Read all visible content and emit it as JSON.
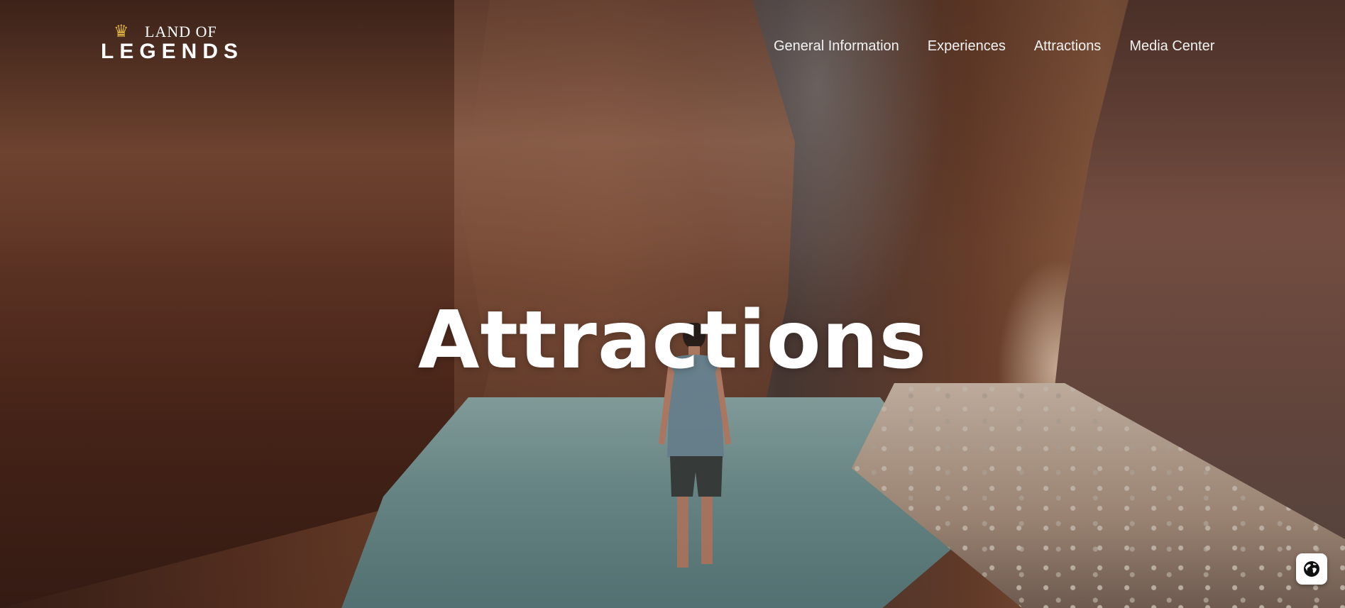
{
  "brand": {
    "logo_top": "LAND OF",
    "logo_bottom": "LEGENDS",
    "crown_icon": "crown-icon"
  },
  "nav": {
    "items": [
      {
        "label": "General Information"
      },
      {
        "label": "Experiences"
      },
      {
        "label": "Attractions"
      },
      {
        "label": "Media Center"
      }
    ]
  },
  "hero": {
    "title": "Attractions",
    "background": "canyon-hiker-photo"
  },
  "widgets": {
    "language_button_icon": "globe-icon"
  },
  "colors": {
    "crown": "#e0b443",
    "text": "#ffffff"
  }
}
